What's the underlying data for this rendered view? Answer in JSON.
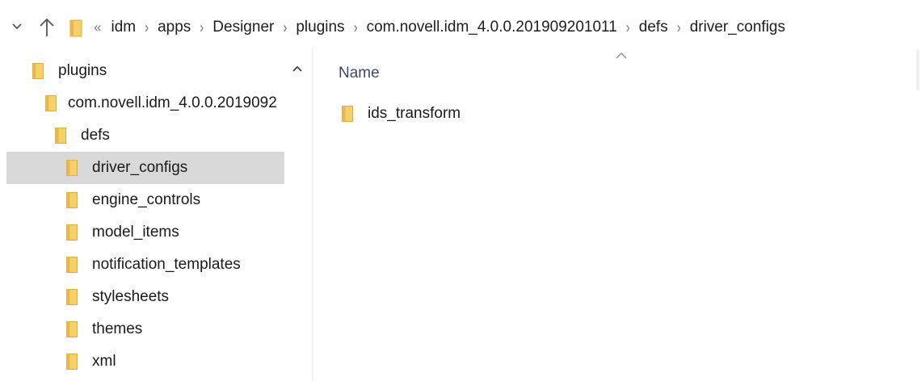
{
  "address_bar": {
    "overflow_label": "«",
    "separator": "›",
    "crumbs": [
      "idm",
      "apps",
      "Designer",
      "plugins",
      "com.novell.idm_4.0.0.201909201011",
      "defs",
      "driver_configs"
    ]
  },
  "nav_pane": {
    "items": [
      {
        "label": "plugins",
        "selected": false
      },
      {
        "label": "com.novell.idm_4.0.0.2019092",
        "selected": false
      },
      {
        "label": "defs",
        "selected": false
      },
      {
        "label": "driver_configs",
        "selected": true
      },
      {
        "label": "engine_controls",
        "selected": false
      },
      {
        "label": "model_items",
        "selected": false
      },
      {
        "label": "notification_templates",
        "selected": false
      },
      {
        "label": "stylesheets",
        "selected": false
      },
      {
        "label": "themes",
        "selected": false
      },
      {
        "label": "xml",
        "selected": false
      }
    ]
  },
  "content": {
    "column_header": "Name",
    "items": [
      {
        "name": "ids_transform",
        "type": "folder"
      }
    ]
  },
  "colors": {
    "folder_fill": "#f6d06b",
    "folder_edge": "#dcae3c",
    "selection": "#d9d9d9",
    "header_text": "#3b4a63"
  }
}
